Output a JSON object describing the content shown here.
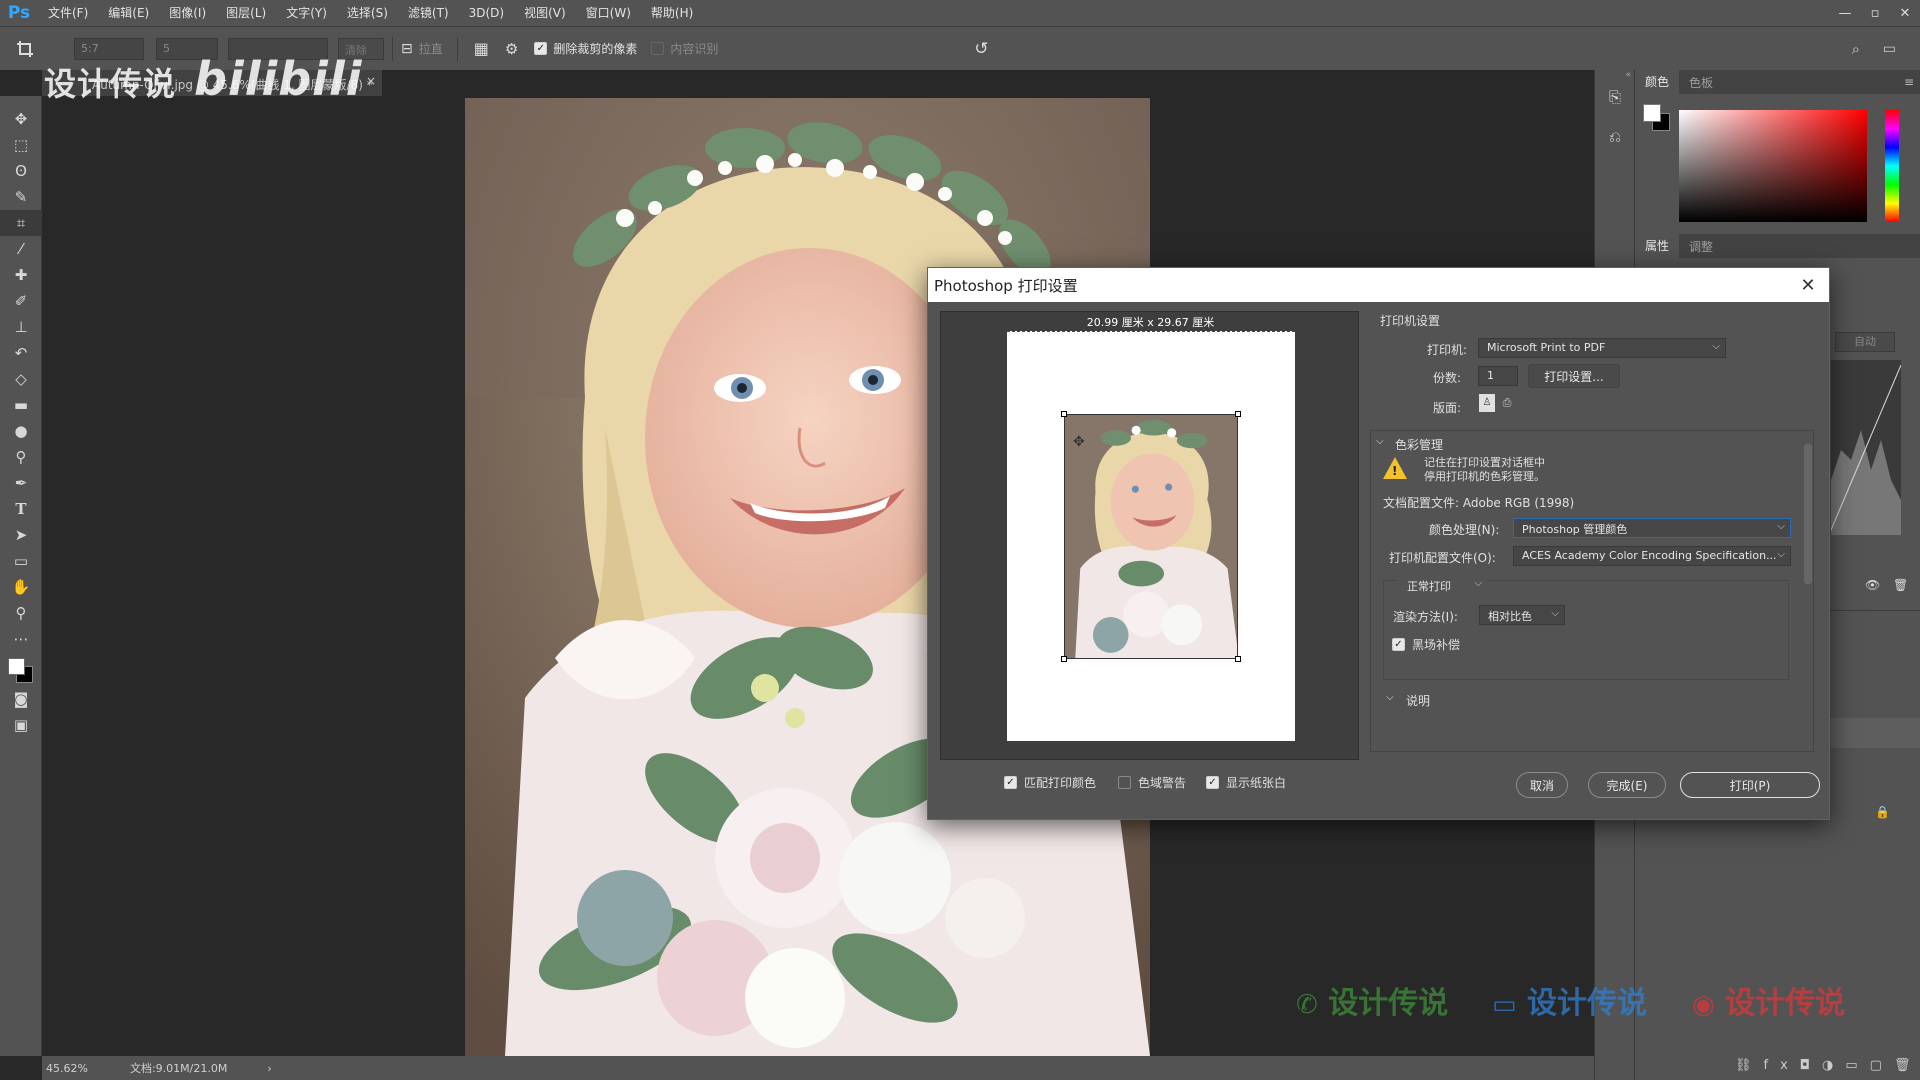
{
  "menubar": {
    "logo": "Ps",
    "items": [
      "文件(F)",
      "编辑(E)",
      "图像(I)",
      "图层(L)",
      "文字(Y)",
      "选择(S)",
      "滤镜(T)",
      "3D(D)",
      "视图(V)",
      "窗口(W)",
      "帮助(H)"
    ],
    "window_controls": [
      "—",
      "▫",
      "✕"
    ]
  },
  "options": {
    "ratio_value": "5:7",
    "width_value": "5",
    "clear_label": "清除",
    "straighten_label": "拉直",
    "delete_cropped_label": "删除裁剪的像素",
    "delete_cropped_checked": true,
    "content_aware_label": "内容识别",
    "content_aware_checked": false
  },
  "overlay_watermark": {
    "text": "设计传说",
    "bili": "bilibili"
  },
  "document_tab": {
    "title": "Autumn-Olivi.jpg @ 45.6%(曲线 1, 图层蒙版/8) *",
    "close": "×"
  },
  "status": {
    "zoom": "45.62%",
    "doc_info": "文档:9.01M/21.0M",
    "arrow": "›"
  },
  "right_panel": {
    "color_tabs": [
      "颜色",
      "色板"
    ],
    "props_tabs": [
      "属性",
      "调整"
    ],
    "auto_label": "自动"
  },
  "dialog": {
    "title": "Photoshop 打印设置",
    "close": "✕",
    "preview_size": "20.99 厘米 x 29.67 厘米",
    "printer_section": "打印机设置",
    "printer_label": "打印机:",
    "printer_value": "Microsoft Print to PDF",
    "copies_label": "份数:",
    "copies_value": "1",
    "print_settings_button": "打印设置...",
    "layout_label": "版面:",
    "color_mgmt_section": "色彩管理",
    "warning_line1": "记住在打印设置对话框中",
    "warning_line2": "停用打印机的色彩管理。",
    "doc_profile": "文档配置文件: Adobe RGB (1998)",
    "color_handling_label": "颜色处理(N):",
    "color_handling_value": "Photoshop 管理颜色",
    "printer_profile_label": "打印机配置文件(O):",
    "printer_profile_value": "ACES Academy Color Encoding Specification...",
    "print_mode_value": "正常打印",
    "rendering_label": "渲染方法(I):",
    "rendering_value": "相对比色",
    "bpc_label": "黑场补偿",
    "bpc_checked": true,
    "description_section": "说明",
    "match_colors_label": "匹配打印颜色",
    "match_colors_checked": true,
    "gamut_warning_label": "色域警告",
    "gamut_warning_checked": false,
    "show_paper_white_label": "显示纸张白",
    "show_paper_white_checked": true,
    "cancel_button": "取消",
    "done_button": "完成(E)",
    "print_button": "打印(P)"
  },
  "bottom_watermarks": [
    "设计传说",
    "设计传说",
    "设计传说"
  ],
  "colors": {
    "ui_bg": "#535353",
    "canvas_bg": "#282828",
    "dialog_accent": "#2b6cb3",
    "ps_blue": "#31a8ff",
    "wechat_green": "#3e8e3a",
    "blue_wm": "#2f7fd4",
    "weibo_red": "#d9383a"
  },
  "icons": [
    "crop-icon",
    "move-icon",
    "marquee-icon",
    "lasso-icon",
    "quick-select-icon",
    "eyedropper-icon",
    "healing-icon",
    "brush-icon",
    "stamp-icon",
    "history-brush-icon",
    "eraser-icon",
    "gradient-icon",
    "blur-icon",
    "dodge-icon",
    "pen-icon",
    "type-icon",
    "path-select-icon",
    "rectangle-icon",
    "hand-icon",
    "zoom-icon",
    "more-icon",
    "warning-icon"
  ]
}
